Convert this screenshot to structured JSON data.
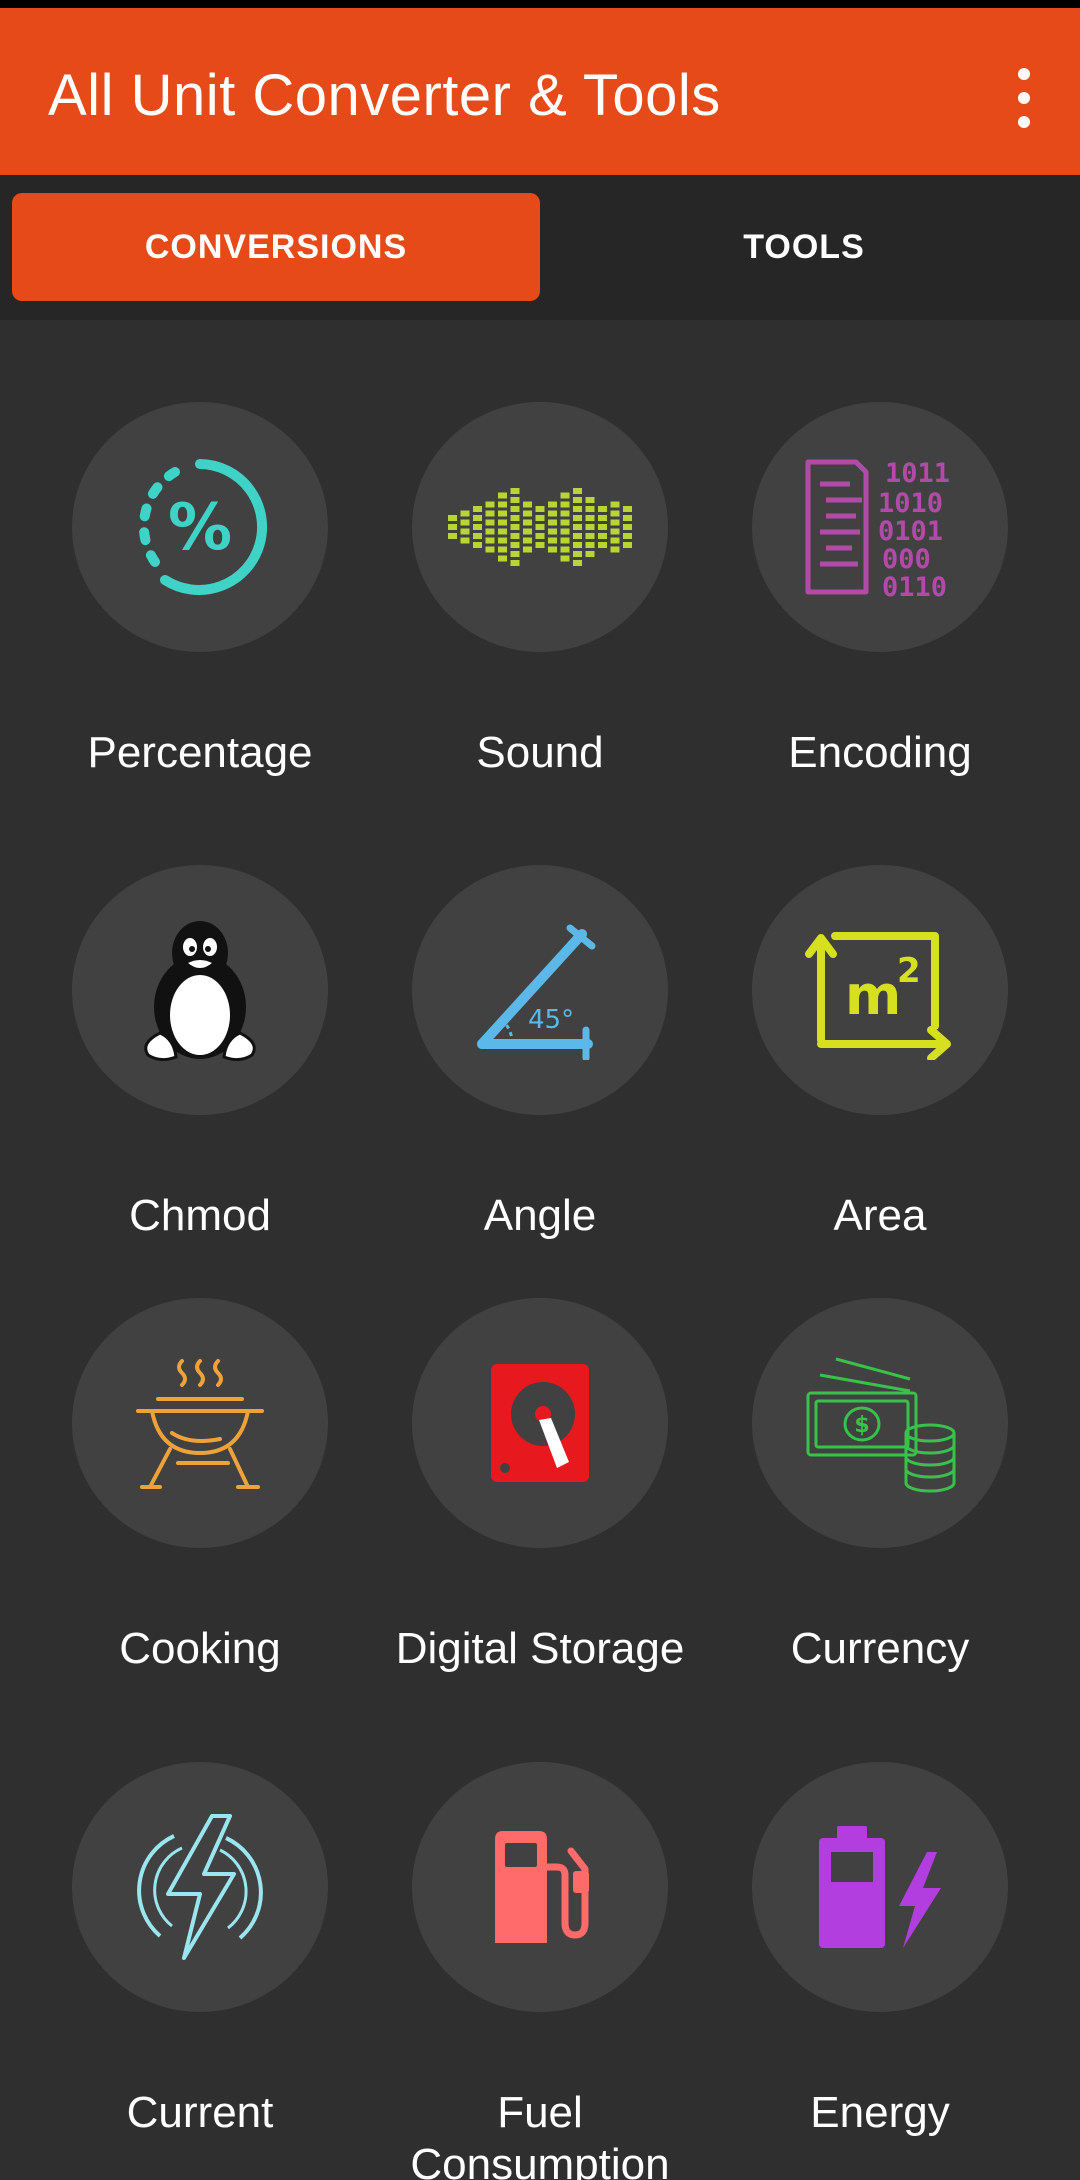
{
  "app_bar": {
    "title": "All Unit Converter & Tools",
    "menu_icon": "more-vert-icon",
    "color": "#e64a19"
  },
  "tabs": [
    {
      "label": "CONVERSIONS",
      "active": true
    },
    {
      "label": "TOOLS",
      "active": false
    }
  ],
  "tiles": [
    {
      "label": "Percentage",
      "icon": "percentage-icon",
      "color": "#3fd3c8"
    },
    {
      "label": "Sound",
      "icon": "sound-wave-icon",
      "color": "#b8d435"
    },
    {
      "label": "Encoding",
      "icon": "binary-code-icon",
      "color": "#b24aa8"
    },
    {
      "label": "Chmod",
      "icon": "linux-penguin-icon",
      "color": "#ffffff"
    },
    {
      "label": "Angle",
      "icon": "angle-icon",
      "color": "#5bb8e8"
    },
    {
      "label": "Area",
      "icon": "area-m2-icon",
      "color": "#d6e01f"
    },
    {
      "label": "Cooking",
      "icon": "grill-icon",
      "color": "#f0a23a"
    },
    {
      "label": "Digital Storage",
      "icon": "hard-drive-icon",
      "color": "#e8191e"
    },
    {
      "label": "Currency",
      "icon": "money-coins-icon",
      "color": "#39c24a"
    },
    {
      "label": "Current",
      "icon": "lightning-bolt-icon",
      "color": "#9ae6f0"
    },
    {
      "label": "Fuel Consumption",
      "icon": "fuel-pump-icon",
      "color": "#ff6b6b"
    },
    {
      "label": "Energy",
      "icon": "battery-bolt-icon",
      "color": "#b23ee0"
    }
  ]
}
